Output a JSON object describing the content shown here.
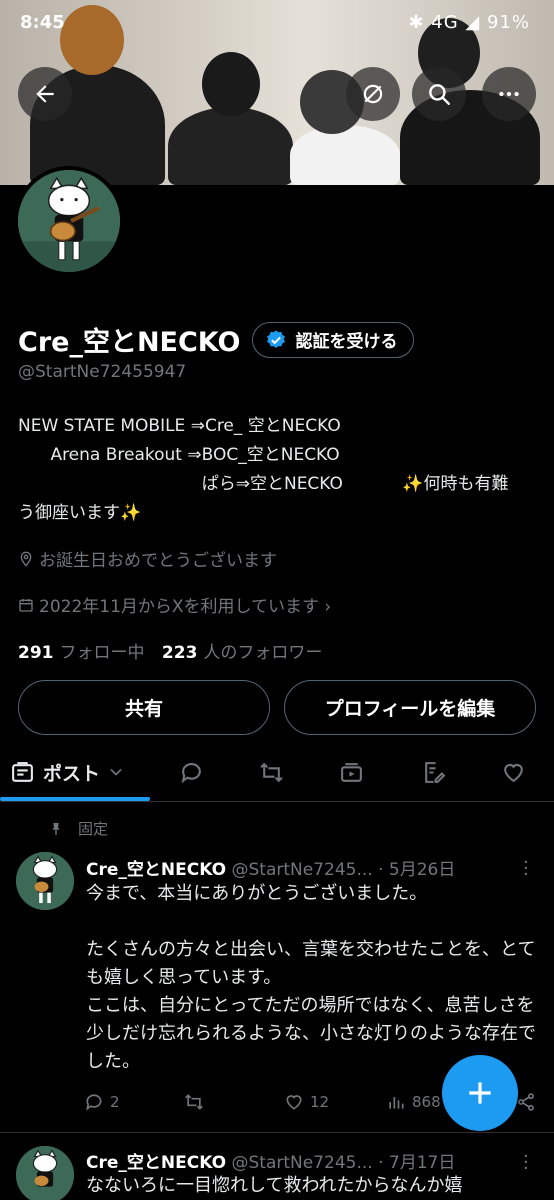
{
  "status_bar": {
    "time": "8:45",
    "right": "✱ 4G ◢ 91%"
  },
  "header": {
    "back_icon": "arrow-left-icon",
    "grok_icon": "circle-slash-icon",
    "search_icon": "search-icon",
    "more_icon": "more-horizontal-icon"
  },
  "profile": {
    "display_name": "Cre_空とNECKO",
    "verify_label": "認証を受ける",
    "handle": "@StartNe72455947",
    "bio_line1": "NEW STATE MOBILE ⇒Cre_ 空とNECKO",
    "bio_line2": "      Arena Breakout ⇒BOC_空とNECKO",
    "bio_line3": "                                  ぱら⇒空とNECKO           ✨何時も有難",
    "bio_line4": "う御座います✨",
    "location": "お誕生日おめでとうございます",
    "joined": "2022年11月からXを利用しています ›",
    "following_count": "291",
    "following_label": "フォロー中",
    "followers_count": "223",
    "followers_label": "人のフォロワー",
    "share_label": "共有",
    "edit_label": "プロフィールを編集"
  },
  "tabs": {
    "posts_label": "ポスト"
  },
  "pinned_label": "固定",
  "tweets": [
    {
      "name": "Cre_空とNECKO",
      "handle_date": " @StartNe7245... · 5月26日",
      "text": "今まで、本当にありがとうございました。\n\nたくさんの方々と出会い、言葉を交わせたことを、とても嬉しく思っています。\nここは、自分にとってただの場所ではなく、息苦しさを少しだけ忘れられるような、小さな灯りのような存在でした。",
      "replies": "2",
      "likes": "12",
      "views": "868"
    },
    {
      "name": "Cre_空とNECKO",
      "handle_date": " @StartNe7245... · 7月17日",
      "text": "なないろに一目惚れして救われたからなんか嬉"
    }
  ],
  "colors": {
    "accent": "#1d9bf0",
    "muted": "#71767b",
    "border": "#2f3336"
  }
}
